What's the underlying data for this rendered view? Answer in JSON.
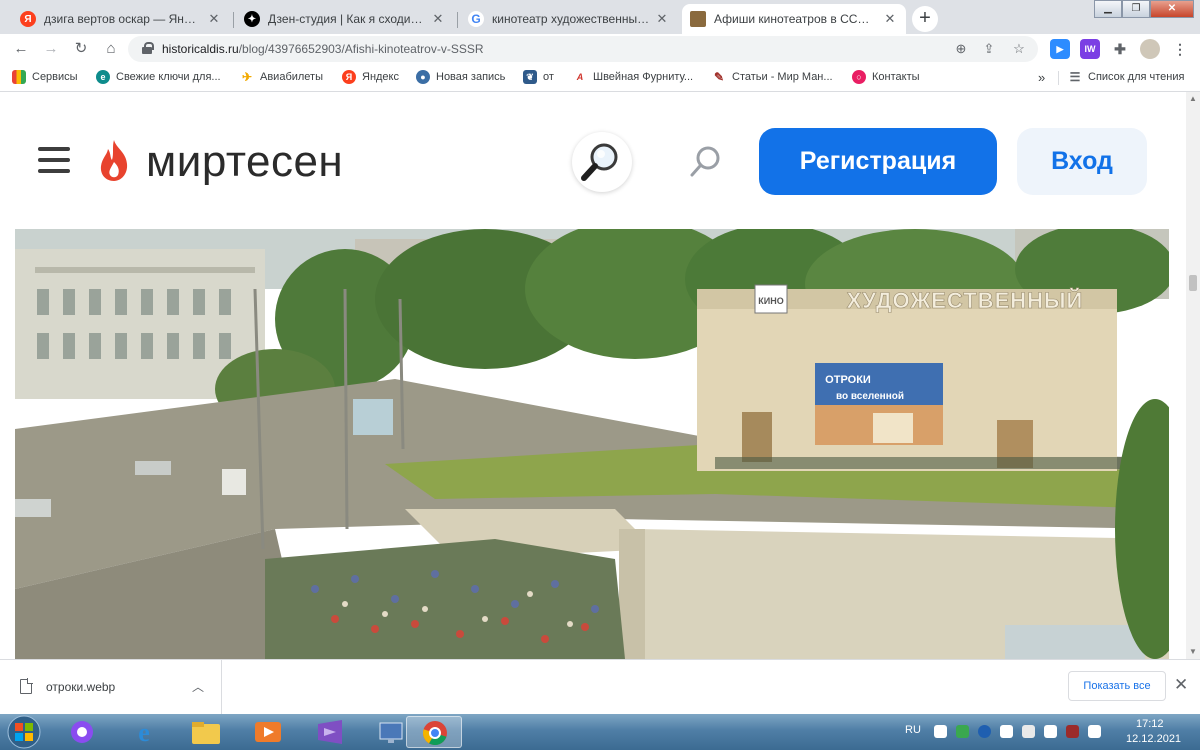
{
  "browser": {
    "tabs": [
      {
        "title": "дзига вертов оскар — Яндекс: н",
        "favicon": "yandex-icon",
        "active": false
      },
      {
        "title": "Дзен-студия | Как я сходила в \"",
        "favicon": "dzen-icon",
        "active": false
      },
      {
        "title": "кинотеатр художественный ссср",
        "favicon": "google-icon",
        "active": false
      },
      {
        "title": "Афиши кинотеатров в СССР - И",
        "favicon": "historicaldis-icon",
        "active": true
      }
    ],
    "url": {
      "domain": "historicaldis.ru",
      "path": "/blog/43976652903/Afishi-kinoteatrov-v-SSSR"
    },
    "bookmarks": [
      {
        "label": "Сервисы",
        "icon": "apps-grid-icon"
      },
      {
        "label": "Свежие ключи для...",
        "icon": "e-icon"
      },
      {
        "label": "Авиабилеты",
        "icon": "plane-icon"
      },
      {
        "label": "Яндекс",
        "icon": "yandex-icon"
      },
      {
        "label": "Новая запись",
        "icon": "user-icon"
      },
      {
        "label": "от",
        "icon": "bird-icon"
      },
      {
        "label": "Швейная Фурниту...",
        "icon": "needle-icon"
      },
      {
        "label": "Статьи - Мир Ман...",
        "icon": "manicure-icon"
      },
      {
        "label": "Контакты",
        "icon": "contacts-icon"
      }
    ],
    "bookmarks_overflow": "»",
    "reading_list": "Список для чтения",
    "colors": {
      "tabstrip": "#dee1e6",
      "accent": "#1a73e8"
    }
  },
  "site": {
    "logo": "миртесен",
    "register_label": "Регистрация",
    "login_label": "Вход",
    "colors": {
      "brand_red": "#e8432e",
      "button_blue": "#1272e8"
    }
  },
  "photo": {
    "sign_text": "ХУДОЖЕСТВЕННЫЙ",
    "poster_line1": "ОТРОКИ",
    "poster_line2": "во вселенной",
    "small_sign": "КИНО"
  },
  "downloads": {
    "file_name": "отроки.webp",
    "show_all": "Показать все"
  },
  "taskbar": {
    "language": "RU",
    "time": "17:12",
    "date": "12.12.2021"
  }
}
